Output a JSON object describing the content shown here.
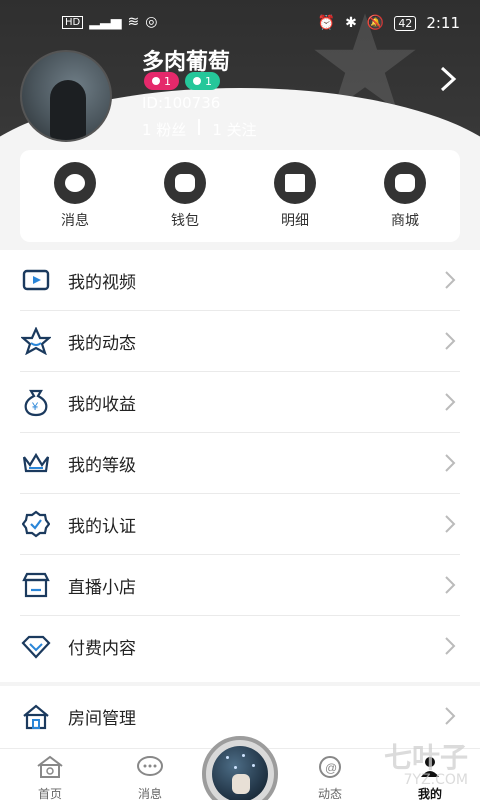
{
  "statusbar": {
    "left_icons": [
      "hd-icon",
      "signal-icon",
      "wifi-icon",
      "sync-icon"
    ],
    "battery": "42",
    "time": "2:11"
  },
  "profile": {
    "name": "多肉葡萄",
    "badges": [
      {
        "icon": "mic-icon",
        "value": "1",
        "color": "#e5296b"
      },
      {
        "icon": "moon-icon",
        "value": "1",
        "color": "#25c79a"
      }
    ],
    "id_text": "ID:100736",
    "fans_text": "1 粉丝",
    "follow_text": "1 关注"
  },
  "quick_actions": [
    {
      "label": "消息",
      "icon": "chat-bubble-icon"
    },
    {
      "label": "钱包",
      "icon": "wallet-icon"
    },
    {
      "label": "明细",
      "icon": "list-icon"
    },
    {
      "label": "商城",
      "icon": "store-icon"
    }
  ],
  "menu": [
    {
      "label": "我的视频",
      "icon": "video-icon"
    },
    {
      "label": "我的动态",
      "icon": "star-icon"
    },
    {
      "label": "我的收益",
      "icon": "money-bag-icon"
    },
    {
      "label": "我的等级",
      "icon": "crown-icon"
    },
    {
      "label": "我的认证",
      "icon": "verified-icon"
    },
    {
      "label": "直播小店",
      "icon": "shop-icon"
    },
    {
      "label": "付费内容",
      "icon": "diamond-icon"
    }
  ],
  "menu2": [
    {
      "label": "房间管理",
      "icon": "home-icon"
    }
  ],
  "tabs": [
    {
      "label": "首页",
      "icon": "home-icon"
    },
    {
      "label": "消息",
      "icon": "message-icon"
    },
    {
      "label": "动态",
      "icon": "dynamic-icon"
    },
    {
      "label": "我的",
      "icon": "user-icon",
      "active": true
    }
  ],
  "watermark": {
    "main": "七叶子",
    "sub": "7YZ.COM"
  }
}
